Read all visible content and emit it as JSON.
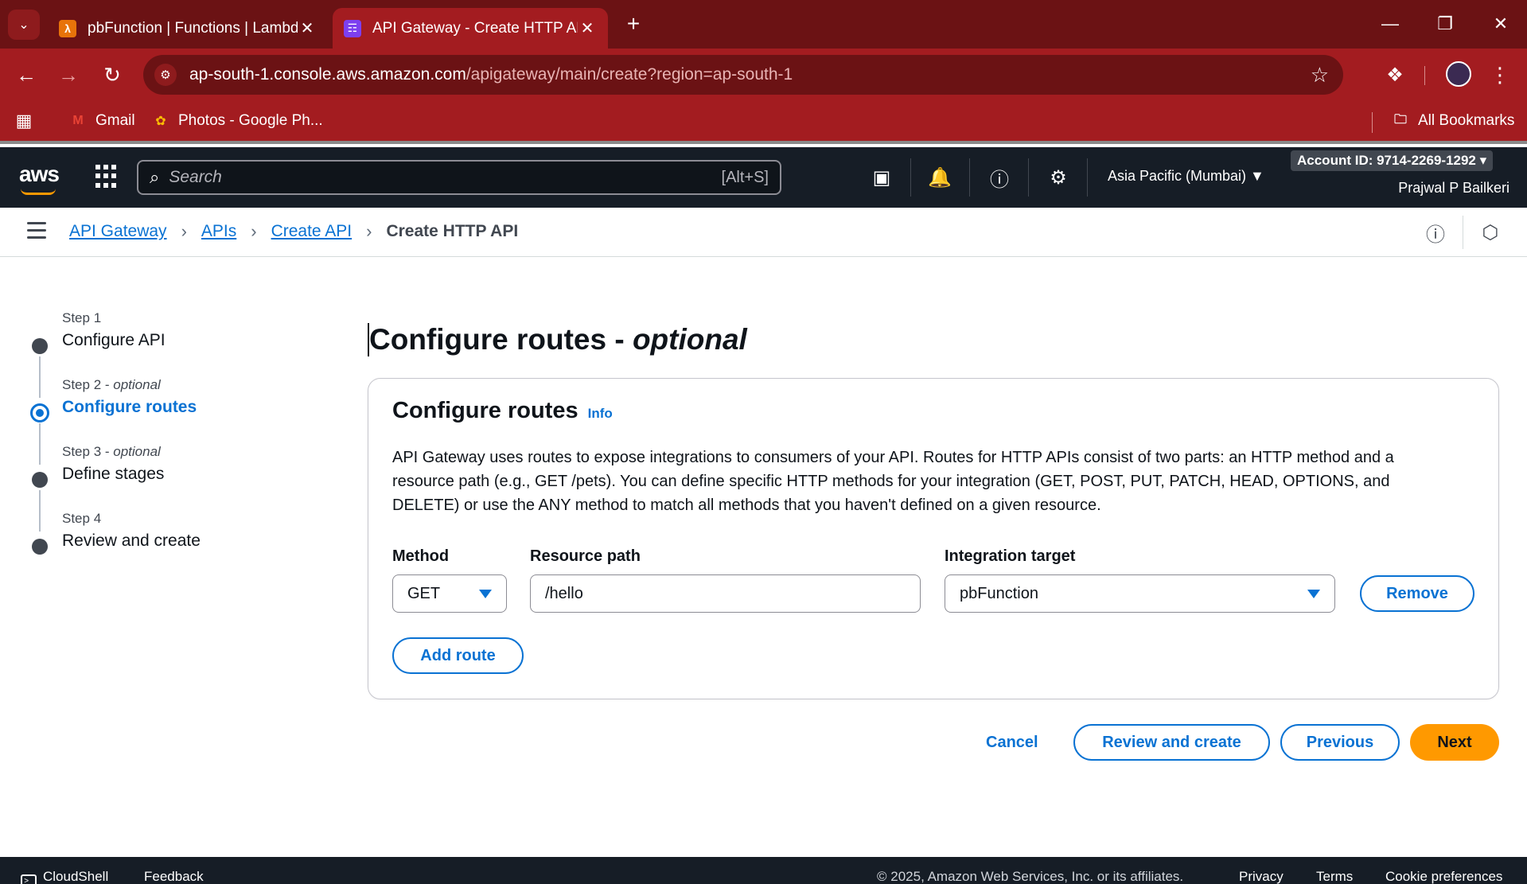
{
  "browser": {
    "tabs": [
      {
        "title": "pbFunction | Functions | Lambda",
        "favicon": "lambda-icon",
        "favicon_color": "#e8730a",
        "active": false
      },
      {
        "title": "API Gateway - Create HTTP API",
        "favicon": "api-gateway-icon",
        "favicon_color": "#7d3ff0",
        "active": true
      }
    ],
    "url_host": "ap-south-1.console.aws.amazon.com",
    "url_path": "/apigateway/main/create?region=ap-south-1",
    "bookmarks": [
      {
        "label": "Gmail",
        "icon": "gmail-icon"
      },
      {
        "label": "Photos - Google Ph...",
        "icon": "google-photos-icon"
      }
    ],
    "all_bookmarks_label": "All Bookmarks"
  },
  "aws_nav": {
    "search_placeholder": "Search",
    "search_shortcut": "[Alt+S]",
    "region": "Asia Pacific (Mumbai)",
    "account_id": "Account ID: 9714-2269-1292",
    "user_name": "Prajwal P Bailkeri"
  },
  "breadcrumb": {
    "items": [
      "API Gateway",
      "APIs",
      "Create API"
    ],
    "current": "Create HTTP API"
  },
  "steps": [
    {
      "label": "Step 1",
      "optional": "",
      "name": "Configure API",
      "active": false
    },
    {
      "label": "Step 2",
      "optional": "optional",
      "name": "Configure routes",
      "active": true
    },
    {
      "label": "Step 3",
      "optional": "optional",
      "name": "Define stages",
      "active": false
    },
    {
      "label": "Step 4",
      "optional": "",
      "name": "Review and create",
      "active": false
    }
  ],
  "page": {
    "title_main": "Configure routes - ",
    "title_optional": "optional"
  },
  "panel": {
    "title": "Configure routes",
    "info_label": "Info",
    "description": "API Gateway uses routes to expose integrations to consumers of your API. Routes for HTTP APIs consist of two parts: an HTTP method and a resource path (e.g., GET /pets). You can define specific HTTP methods for your integration (GET, POST, PUT, PATCH, HEAD, OPTIONS, and DELETE) or use the ANY method to match all methods that you haven't defined on a given resource.",
    "method_label": "Method",
    "resource_path_label": "Resource path",
    "integration_target_label": "Integration target",
    "route": {
      "method": "GET",
      "resource_path": "/hello",
      "integration_target": "pbFunction"
    },
    "remove_label": "Remove",
    "add_route_label": "Add route"
  },
  "actions": {
    "cancel": "Cancel",
    "review_and_create": "Review and create",
    "previous": "Previous",
    "next": "Next"
  },
  "footer": {
    "cloudshell": "CloudShell",
    "feedback": "Feedback",
    "copyright": "© 2025, Amazon Web Services, Inc. or its affiliates.",
    "privacy": "Privacy",
    "terms": "Terms",
    "cookie_preferences": "Cookie preferences"
  },
  "colors": {
    "accent": "#0972d3",
    "primary_button": "#ff9900",
    "aws_nav_bg": "#161d26",
    "browser_frame": "#a31c20"
  }
}
